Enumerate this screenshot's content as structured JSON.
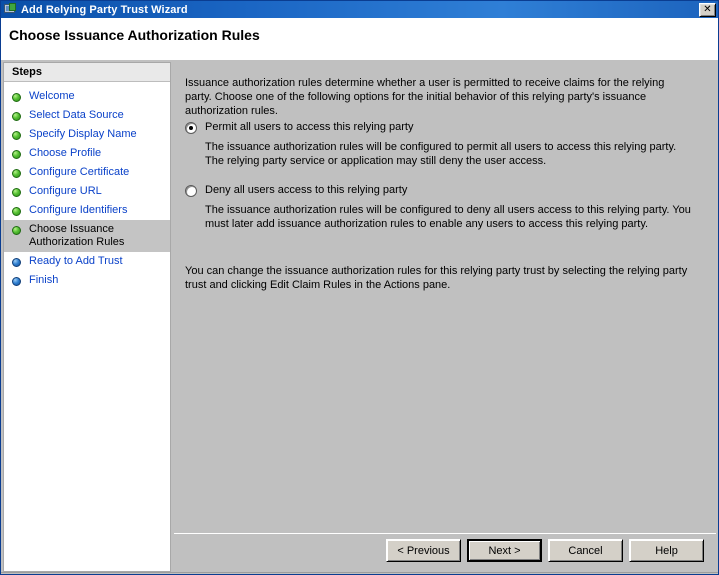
{
  "window": {
    "title": "Add Relying Party Trust Wizard",
    "icon": "wizard-icon",
    "close_label": "✕",
    "accent_color": "#1b66c4",
    "page_title": "Choose Issuance Authorization Rules"
  },
  "sidebar": {
    "header": "Steps",
    "items": [
      {
        "label": "Welcome",
        "state": "done"
      },
      {
        "label": "Select Data Source",
        "state": "done"
      },
      {
        "label": "Specify Display Name",
        "state": "done"
      },
      {
        "label": "Choose Profile",
        "state": "done"
      },
      {
        "label": "Configure Certificate",
        "state": "done"
      },
      {
        "label": "Configure URL",
        "state": "done"
      },
      {
        "label": "Configure Identifiers",
        "state": "done"
      },
      {
        "label": "Choose Issuance\nAuthorization Rules",
        "state": "current"
      },
      {
        "label": "Ready to Add Trust",
        "state": "pending"
      },
      {
        "label": "Finish",
        "state": "pending"
      }
    ]
  },
  "content": {
    "intro": "Issuance authorization rules determine whether a user is permitted to receive claims for the relying party. Choose one of the following options for the initial behavior of this relying party's issuance authorization rules.",
    "options": [
      {
        "label": "Permit all users to access this relying party",
        "description": "The issuance authorization rules will be configured to permit all users to access this relying party. The relying party service or application may still deny the user access.",
        "selected": true
      },
      {
        "label": "Deny all users access to this relying party",
        "description": "The issuance authorization rules will be configured to deny all users access to this relying party. You must later add issuance authorization rules to enable any users to access this relying party.",
        "selected": false
      }
    ],
    "footnote": "You can change the issuance authorization rules for this relying party trust by selecting the relying party trust and clicking Edit Claim Rules in the Actions pane."
  },
  "buttons": {
    "previous": "< Previous",
    "next": "Next >",
    "cancel": "Cancel",
    "help": "Help"
  }
}
